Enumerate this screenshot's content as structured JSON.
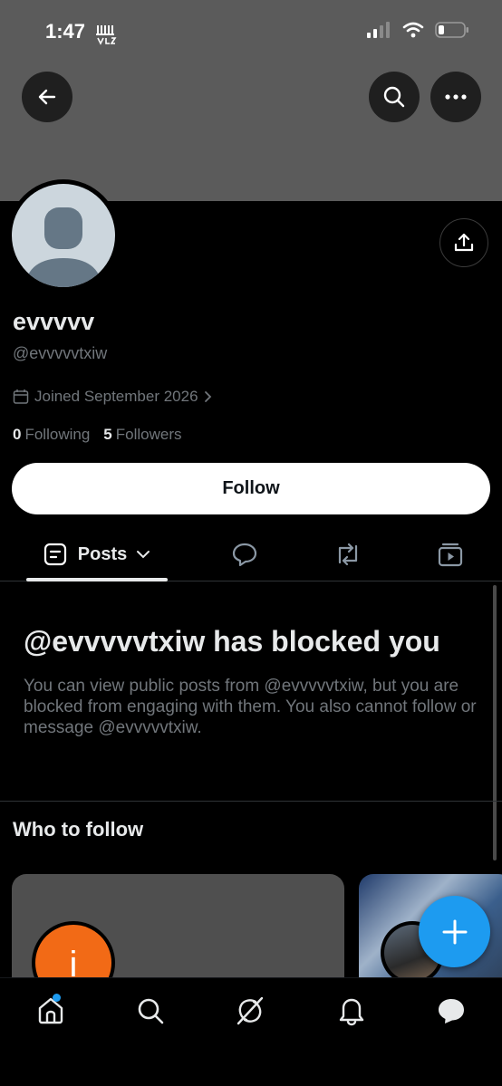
{
  "status_bar": {
    "time": "1:47"
  },
  "profile": {
    "display_name": "evvvvv",
    "handle": "@evvvvvtxiw",
    "joined": "Joined September 2026",
    "following_count": "0",
    "following_label": "Following",
    "followers_count": "5",
    "followers_label": "Followers",
    "follow_button_label": "Follow"
  },
  "tabs": {
    "posts_label": "Posts",
    "items": [
      "posts",
      "replies",
      "reposts",
      "media"
    ]
  },
  "blocked_notice": {
    "title": "@evvvvvtxiw has blocked you",
    "description": "You can view public posts from @evvvvvtxiw, but you are blocked from engaging with them. You also cannot follow or message @evvvvvtxiw."
  },
  "who_to_follow": {
    "title": "Who to follow",
    "cards": [
      {
        "avatar_letter": "i",
        "avatar_color": "#f26a16"
      },
      {
        "avatar_letter": "",
        "avatar_color": "#3b5f8c"
      }
    ]
  },
  "colors": {
    "accent": "#1d9bf0",
    "banner": "#5b5b5b",
    "muted_text": "#71767b"
  },
  "icons": {
    "header": [
      "back-arrow-icon",
      "search-icon",
      "more-icon"
    ],
    "profile": [
      "share-icon",
      "calendar-icon",
      "chevron-right-icon"
    ],
    "nav": [
      "home-icon",
      "search-icon",
      "grok-icon",
      "bell-icon",
      "messages-icon"
    ]
  }
}
